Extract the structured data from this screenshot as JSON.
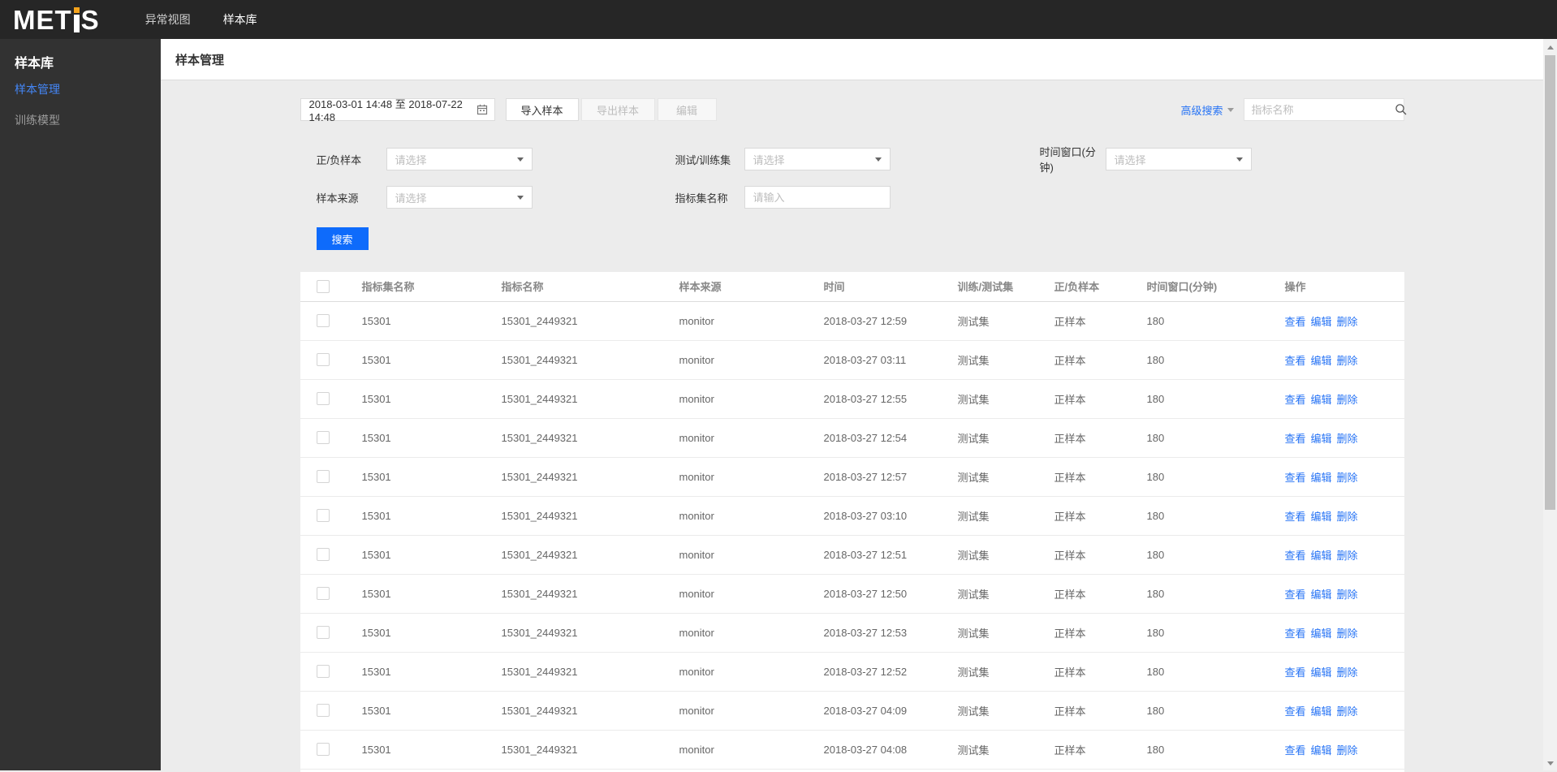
{
  "colors": {
    "navbar_bg": "#262626",
    "sidebar_bg": "#323232",
    "content_bg": "#ececec",
    "accent_blue": "#2673f5",
    "button_blue": "#0e6bfb",
    "sidebar_active": "#4486f6",
    "logo_orange": "#f5a31b"
  },
  "navbar": {
    "logo_left": "MET",
    "logo_right": "S",
    "items": [
      {
        "label": "异常视图",
        "active": false
      },
      {
        "label": "样本库",
        "active": true
      }
    ]
  },
  "sidebar": {
    "title": "样本库",
    "items": [
      {
        "label": "样本管理",
        "active": true
      },
      {
        "label": "训练模型",
        "active": false
      }
    ]
  },
  "page": {
    "title": "样本管理"
  },
  "toolbar": {
    "date_range": "2018-03-01 14:48 至 2018-07-22 14:48",
    "import_label": "导入样本",
    "export_label": "导出样本",
    "edit_label": "编辑",
    "advanced_search_label": "高级搜索",
    "search_placeholder": "指标名称"
  },
  "filters": {
    "row1": [
      {
        "label": "正/负样本",
        "placeholder": "请选择"
      },
      {
        "label": "测试/训练集",
        "placeholder": "请选择"
      },
      {
        "label": "时间窗口(分钟)",
        "placeholder": "请选择"
      }
    ],
    "row2": [
      {
        "label": "样本来源",
        "placeholder": "请选择"
      },
      {
        "label": "指标集名称",
        "placeholder": "请输入"
      }
    ],
    "search_label": "搜索"
  },
  "table": {
    "columns": [
      "指标集名称",
      "指标名称",
      "样本来源",
      "时间",
      "训练/测试集",
      "正/负样本",
      "时间窗口(分钟)",
      "操作"
    ],
    "actions": [
      "查看",
      "编辑",
      "删除"
    ],
    "rows": [
      {
        "set": "15301",
        "metric": "15301_2449321",
        "source": "monitor",
        "time": "2018-03-27 12:59",
        "dataset": "测试集",
        "polarity": "正样本",
        "window": "180"
      },
      {
        "set": "15301",
        "metric": "15301_2449321",
        "source": "monitor",
        "time": "2018-03-27 03:11",
        "dataset": "测试集",
        "polarity": "正样本",
        "window": "180"
      },
      {
        "set": "15301",
        "metric": "15301_2449321",
        "source": "monitor",
        "time": "2018-03-27 12:55",
        "dataset": "测试集",
        "polarity": "正样本",
        "window": "180"
      },
      {
        "set": "15301",
        "metric": "15301_2449321",
        "source": "monitor",
        "time": "2018-03-27 12:54",
        "dataset": "测试集",
        "polarity": "正样本",
        "window": "180"
      },
      {
        "set": "15301",
        "metric": "15301_2449321",
        "source": "monitor",
        "time": "2018-03-27 12:57",
        "dataset": "测试集",
        "polarity": "正样本",
        "window": "180"
      },
      {
        "set": "15301",
        "metric": "15301_2449321",
        "source": "monitor",
        "time": "2018-03-27 03:10",
        "dataset": "测试集",
        "polarity": "正样本",
        "window": "180"
      },
      {
        "set": "15301",
        "metric": "15301_2449321",
        "source": "monitor",
        "time": "2018-03-27 12:51",
        "dataset": "测试集",
        "polarity": "正样本",
        "window": "180"
      },
      {
        "set": "15301",
        "metric": "15301_2449321",
        "source": "monitor",
        "time": "2018-03-27 12:50",
        "dataset": "测试集",
        "polarity": "正样本",
        "window": "180"
      },
      {
        "set": "15301",
        "metric": "15301_2449321",
        "source": "monitor",
        "time": "2018-03-27 12:53",
        "dataset": "测试集",
        "polarity": "正样本",
        "window": "180"
      },
      {
        "set": "15301",
        "metric": "15301_2449321",
        "source": "monitor",
        "time": "2018-03-27 12:52",
        "dataset": "测试集",
        "polarity": "正样本",
        "window": "180"
      },
      {
        "set": "15301",
        "metric": "15301_2449321",
        "source": "monitor",
        "time": "2018-03-27 04:09",
        "dataset": "测试集",
        "polarity": "正样本",
        "window": "180"
      },
      {
        "set": "15301",
        "metric": "15301_2449321",
        "source": "monitor",
        "time": "2018-03-27 04:08",
        "dataset": "测试集",
        "polarity": "正样本",
        "window": "180"
      }
    ]
  }
}
